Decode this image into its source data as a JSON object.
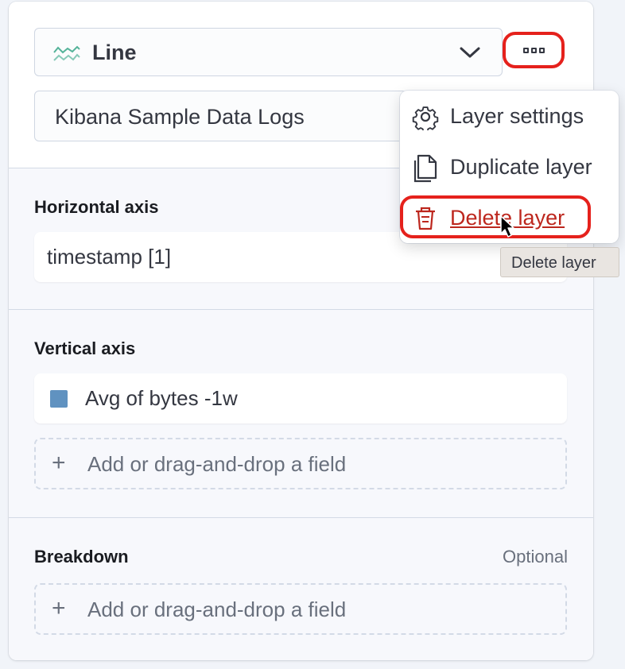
{
  "layer": {
    "chart_type": {
      "label": "Line",
      "icon": "line-chart-icon"
    },
    "datasource": "Kibana Sample Data Logs",
    "more_button": {
      "icon": "more-dots-icon"
    }
  },
  "horizontal_axis": {
    "title": "Horizontal axis",
    "field": "timestamp [1]"
  },
  "vertical_axis": {
    "title": "Vertical axis",
    "metric": {
      "label": "Avg of bytes -1w",
      "color": "#6092c0"
    },
    "add_field": "Add or drag-and-drop a field"
  },
  "breakdown": {
    "title": "Breakdown",
    "optional": "Optional",
    "add_field": "Add or drag-and-drop a field"
  },
  "menu": {
    "items": [
      {
        "label": "Layer settings",
        "icon": "gear-icon"
      },
      {
        "label": "Duplicate layer",
        "icon": "copy-icon"
      },
      {
        "label": "Delete layer",
        "icon": "trash-icon",
        "danger": true
      }
    ]
  },
  "tooltip": "Delete layer",
  "colors": {
    "danger": "#bd271e",
    "highlight_ring": "#e5211c",
    "accent": "#54b399"
  }
}
